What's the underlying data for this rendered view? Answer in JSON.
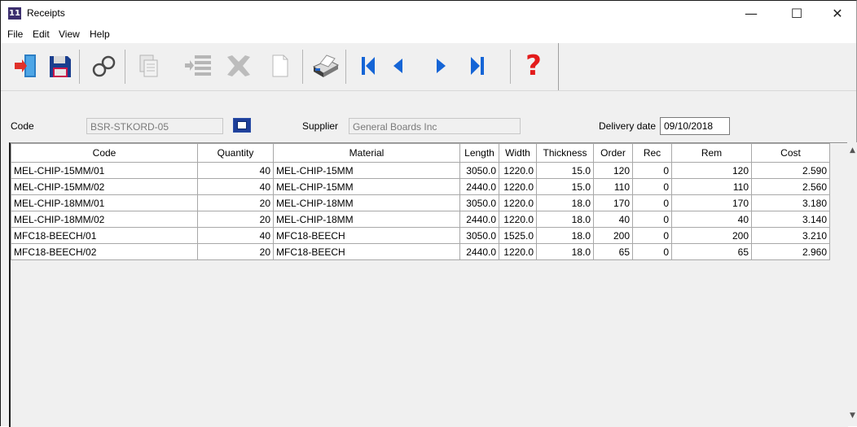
{
  "window": {
    "title": "Receipts",
    "icon_text": "11"
  },
  "controls": {
    "minimize": "—",
    "maximize": "☐",
    "close": "✕"
  },
  "menu": [
    "File",
    "Edit",
    "View",
    "Help"
  ],
  "toolbar": {
    "icons": [
      "exit-icon",
      "save-icon",
      "find-icon",
      "copy-icon",
      "indent-icon",
      "delete-icon",
      "new-icon",
      "print-icon",
      "first-icon",
      "previous-icon",
      "next-icon",
      "last-icon",
      "help-icon"
    ],
    "help_glyph": "?"
  },
  "form": {
    "code_label": "Code",
    "code_value": "BSR-STKORD-05",
    "supplier_label": "Supplier",
    "supplier_value": "General Boards Inc",
    "delivery_label": "Delivery date",
    "delivery_value": "09/10/2018"
  },
  "table": {
    "columns": [
      "Code",
      "Quantity",
      "Material",
      "Length",
      "Width",
      "Thickness",
      "Order",
      "Rec",
      "Rem",
      "Cost"
    ],
    "rows": [
      [
        "MEL-CHIP-15MM/01",
        "40",
        "MEL-CHIP-15MM",
        "3050.0",
        "1220.0",
        "15.0",
        "120",
        "0",
        "120",
        "2.590"
      ],
      [
        "MEL-CHIP-15MM/02",
        "40",
        "MEL-CHIP-15MM",
        "2440.0",
        "1220.0",
        "15.0",
        "110",
        "0",
        "110",
        "2.560"
      ],
      [
        "MEL-CHIP-18MM/01",
        "20",
        "MEL-CHIP-18MM",
        "3050.0",
        "1220.0",
        "18.0",
        "170",
        "0",
        "170",
        "3.180"
      ],
      [
        "MEL-CHIP-18MM/02",
        "20",
        "MEL-CHIP-18MM",
        "2440.0",
        "1220.0",
        "18.0",
        "40",
        "0",
        "40",
        "3.140"
      ],
      [
        "MFC18-BEECH/01",
        "40",
        "MFC18-BEECH",
        "3050.0",
        "1525.0",
        "18.0",
        "200",
        "0",
        "200",
        "3.210"
      ],
      [
        "MFC18-BEECH/02",
        "20",
        "MFC18-BEECH",
        "2440.0",
        "1220.0",
        "18.0",
        "65",
        "0",
        "65",
        "2.960"
      ]
    ]
  },
  "scroll": {
    "up": "▲",
    "down": "▼"
  },
  "colors": {
    "nav_blue": "#1565d6",
    "help_red": "#e31b1b",
    "title_bg": "#ffffff",
    "chrome_bg": "#f0f0f0"
  }
}
